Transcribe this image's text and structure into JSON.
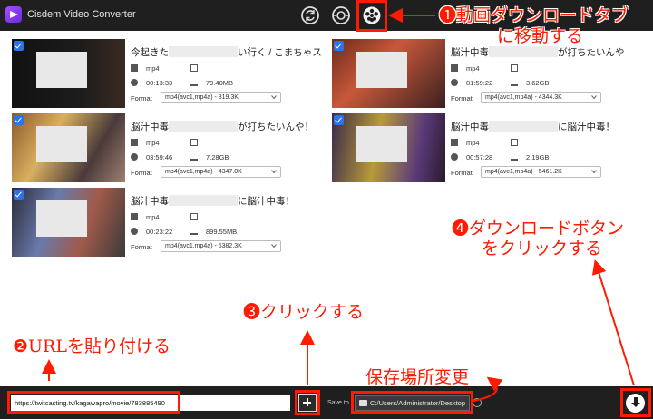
{
  "app": {
    "title": "Cisdem Video Converter"
  },
  "toolbar": {
    "icons": [
      "convert-icon",
      "compress-icon",
      "download-icon"
    ]
  },
  "videos": [
    {
      "title_pre": "今起きた",
      "title_post": "い行く / こまちゃス",
      "format": "mp4",
      "duration": "00:13:33",
      "size": "79.40MB",
      "format_label": "Format",
      "format_value": "mp4(avc1,mp4a) - 819.3K"
    },
    {
      "title_pre": "脳汁中毒",
      "title_post": "が打ちたいんや",
      "format": "mp4",
      "duration": "01:59:22",
      "size": "3.62GB",
      "format_label": "Format",
      "format_value": "mp4(avc1,mp4a) - 4344.3K"
    },
    {
      "title_pre": "脳汁中毒",
      "title_post": "が打ちたいんや！",
      "format": "mp4",
      "duration": "03:59:46",
      "size": "7.28GB",
      "format_label": "Format",
      "format_value": "mp4(avc1,mp4a) - 4347.0K"
    },
    {
      "title_pre": "脳汁中毒",
      "title_post": "に脳汁中毒！",
      "format": "mp4",
      "duration": "00:57:28",
      "size": "2.19GB",
      "format_label": "Format",
      "format_value": "mp4(avc1,mp4a) - 5461.2K"
    },
    {
      "title_pre": "脳汁中毒",
      "title_post": "に脳汁中毒！",
      "format": "mp4",
      "duration": "00:23:22",
      "size": "899.55MB",
      "format_label": "Format",
      "format_value": "mp4(avc1,mp4a) - 5382.3K"
    }
  ],
  "bottom": {
    "url_value": "https://twitcasting.tv/kagawapro/movie/783885490",
    "save_label": "Save to",
    "save_path": "C:/Users/Administrator/Desktop"
  },
  "annotations": {
    "step1_num": "❶",
    "step1_line1": "動画ダウンロードタブ",
    "step1_line2": "に移動する",
    "step2_num": "❷",
    "step2_text": "URLを貼り付ける",
    "step3_num": "❸",
    "step3_text": "クリックする",
    "step4_num": "❹",
    "step4_line1": "ダウンロードボタン",
    "step4_line2": "をクリックする",
    "save_change": "保存場所変更"
  },
  "colors": {
    "highlight": "#ff1a00",
    "titlebar": "#1f1f1f",
    "check": "#2b73e6"
  }
}
